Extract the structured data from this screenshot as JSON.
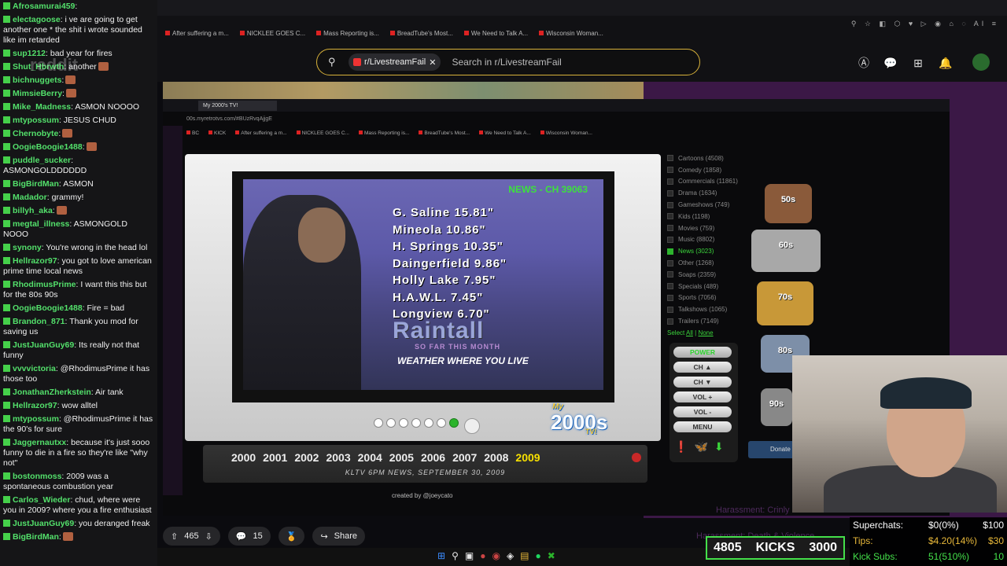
{
  "chat": [
    {
      "user": "Afrosamurai459",
      "text": "",
      "emote": false
    },
    {
      "user": "electagoose",
      "text": "i ve are going to get another one * the shit i wrote sounded like im retarded",
      "emote": false
    },
    {
      "user": "sup1212",
      "text": "bad year for fires",
      "emote": false
    },
    {
      "user": "Shut_Hbrwth",
      "text": "another",
      "emote": true
    },
    {
      "user": "bichnuggets",
      "text": "",
      "emote": true
    },
    {
      "user": "MimsieBerry",
      "text": "",
      "emote": true
    },
    {
      "user": "Mike_Madness",
      "text": "ASMON NOOOO",
      "emote": false
    },
    {
      "user": "mtypossum",
      "text": "JESUS CHUD",
      "emote": false
    },
    {
      "user": "Chernobyte",
      "text": "",
      "emote": true
    },
    {
      "user": "OogieBoogie1488",
      "text": "",
      "emote": true
    },
    {
      "user": "puddle_sucker",
      "text": "ASMONGOLDDDDDD",
      "emote": false
    },
    {
      "user": "BigBirdMan",
      "text": "ASMON",
      "emote": false
    },
    {
      "user": "Madador",
      "text": "grammy!",
      "emote": false
    },
    {
      "user": "billyh_aka",
      "text": "",
      "emote": true
    },
    {
      "user": "megtal_illness",
      "text": "ASMONGOLD NOOO",
      "emote": false
    },
    {
      "user": "synony",
      "text": "You're wrong in the head lol",
      "emote": false
    },
    {
      "user": "Hellrazor97",
      "text": "you got to love american prime time local news",
      "emote": false
    },
    {
      "user": "RhodimusPrime",
      "text": "I want this this but for the 80s 90s",
      "emote": false
    },
    {
      "user": "OogieBoogie1488",
      "text": "Fire = bad",
      "emote": false
    },
    {
      "user": "Brandon_871",
      "text": "Thank you mod for saving us",
      "emote": false
    },
    {
      "user": "JustJuanGuy69",
      "text": "Its really not that funny",
      "emote": false
    },
    {
      "user": "vvvvictoria",
      "text": "@RhodimusPrime it has those too",
      "emote": false
    },
    {
      "user": "JonathanZherkstein",
      "text": "Air tank",
      "emote": false
    },
    {
      "user": "Hellrazor97",
      "text": "wow alltel",
      "emote": false
    },
    {
      "user": "mtypossum",
      "text": "@RhodimusPrime it has the 90's for sure",
      "emote": false
    },
    {
      "user": "Jaggernautxx",
      "text": "because it's just sooo funny to die in a fire so they're like \"why not\"",
      "emote": false
    },
    {
      "user": "bostonmoss",
      "text": "2009 was a spontaneous combustion year",
      "emote": false
    },
    {
      "user": "Carlos_Wieder",
      "text": "chud, where were you in 2009? where you a fire enthusiast",
      "emote": false
    },
    {
      "user": "JustJuanGuy69",
      "text": "you deranged freak",
      "emote": false
    },
    {
      "user": "BigBirdMan",
      "text": "",
      "emote": true
    }
  ],
  "reddit": {
    "logo": "reddit",
    "subreddit_chip": "r/LivestreamFail",
    "search_placeholder": "Search in r/LivestreamFail",
    "bookmarks": [
      "After suffering a m...",
      "NICKLEE GOES C...",
      "Mass Reporting is...",
      "BreadTube's Most...",
      "We Need to Talk A...",
      "Wisconsin Woman..."
    ],
    "upvotes": "465",
    "comments": "15",
    "share": "Share"
  },
  "inner_browser": {
    "tab_title": "My 2000's TV!",
    "url": "00s.myretrotvs.com/#BUzRvqAjjgE",
    "bookmarks": [
      "BC",
      "KICK",
      "After suffering a m...",
      "NICKLEE GOES C...",
      "Mass Reporting is...",
      "BreadTube's Most...",
      "We Need to Talk A...",
      "Wisconsin Woman..."
    ]
  },
  "tv": {
    "channel_label": "NEWS - CH 39063",
    "rain_rows": [
      "G. Saline 15.81\"",
      "Mineola 10.86\"",
      "H. Springs 10.35\"",
      "Daingerfield 9.86\"",
      "Holly Lake 7.95\"",
      "H.A.W.L. 7.45\"",
      "Longview 6.70\""
    ],
    "rain_title": "Raintall",
    "rain_sub": "SO FAR THIS MONTH",
    "rain_tag": "WEATHER WHERE YOU LIVE",
    "logo_my": "My",
    "logo": "2000s",
    "logo_tv": "TV!",
    "years": [
      "2000",
      "2001",
      "2002",
      "2003",
      "2004",
      "2005",
      "2006",
      "2007",
      "2008",
      "2009"
    ],
    "active_year": "2009",
    "broadcast": "KLTV 6PM NEWS, SEPTEMBER 30, 2009",
    "credit": "created by @joeycato"
  },
  "categories": [
    {
      "label": "Cartoons (4508)",
      "checked": false
    },
    {
      "label": "Comedy (1858)",
      "checked": false
    },
    {
      "label": "Commercials (11861)",
      "checked": false
    },
    {
      "label": "Drama (1634)",
      "checked": false
    },
    {
      "label": "Gameshows (749)",
      "checked": false
    },
    {
      "label": "Kids (1198)",
      "checked": false
    },
    {
      "label": "Movies (759)",
      "checked": false
    },
    {
      "label": "Music (8802)",
      "checked": false
    },
    {
      "label": "News (3023)",
      "checked": true
    },
    {
      "label": "Other (1268)",
      "checked": false
    },
    {
      "label": "Soaps (2359)",
      "checked": false
    },
    {
      "label": "Specials (489)",
      "checked": false
    },
    {
      "label": "Sports (7056)",
      "checked": false
    },
    {
      "label": "Talkshows (1065)",
      "checked": false
    },
    {
      "label": "Trailers (7149)",
      "checked": false
    }
  ],
  "select": {
    "label": "Select",
    "all": "All",
    "sep": "|",
    "none": "None"
  },
  "remote": {
    "power": "POWER",
    "ch_up": "CH ▲",
    "ch_down": "CH ▼",
    "vol_up": "VOL +",
    "vol_down": "VOL -",
    "menu": "MENU"
  },
  "decades": [
    "50s",
    "60s",
    "70s",
    "80s",
    "90s"
  ],
  "donate": "Donate",
  "supporters": [
    {
      "label": "Superchats:",
      "value": "$0(0%)",
      "goal": "$100"
    },
    {
      "label": "Tips:",
      "value": "$4.20(14%)",
      "goal": "$30"
    },
    {
      "label": "Kick Subs:",
      "value": "51(510%)",
      "goal": "10"
    }
  ],
  "kicks": {
    "left": "4805",
    "mid": "KICKS",
    "right": "3000"
  },
  "bg_text": {
    "line1": "Harassment: Crinly",
    "line2": "Harassment: Death & Violence"
  },
  "colors": {
    "chat_user": "#53e06b",
    "accent_gold": "#d8b23a",
    "news_green": "#3de03d",
    "active_year": "#f7e000",
    "kick_green": "#44e04a"
  }
}
